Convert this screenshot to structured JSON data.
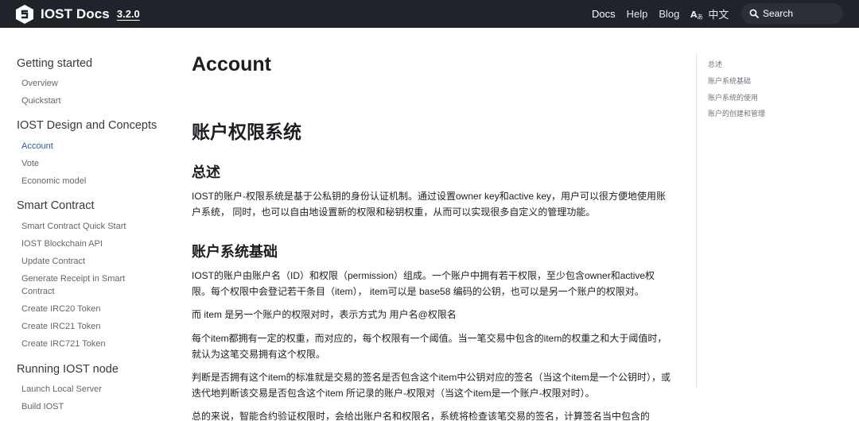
{
  "navbar": {
    "title": "IOST Docs",
    "version": "3.2.0",
    "links": [
      "Docs",
      "Help",
      "Blog"
    ],
    "language": "中文",
    "search_placeholder": "Search",
    "bg_color": "#20232a"
  },
  "sidebar": {
    "groups": [
      {
        "heading": "Getting started",
        "items": [
          "Overview",
          "Quickstart"
        ]
      },
      {
        "heading": "IOST Design and Concepts",
        "items": [
          "Account",
          "Vote",
          "Economic model"
        ]
      },
      {
        "heading": "Smart Contract",
        "items": [
          "Smart Contract Quick Start",
          "IOST Blockchain API",
          "Update Contract",
          "Generate Receipt in Smart Contract",
          "Create IRC20 Token",
          "Create IRC21 Token",
          "Create IRC721 Token"
        ]
      },
      {
        "heading": "Running IOST node",
        "items": [
          "Launch Local Server",
          "Build IOST"
        ]
      }
    ],
    "active_item": "Account",
    "active_color": "#2e5b9f"
  },
  "main": {
    "title": "Account",
    "h1": "账户权限系统",
    "sections": [
      {
        "heading": "总述",
        "paragraphs": [
          "IOST的账户-权限系统是基于公私钥的身份认证机制。通过设置owner key和active key，用户可以很方便地使用账户系统， 同时，也可以自由地设置新的权限和秘钥权重，从而可以实现很多自定义的管理功能。"
        ]
      },
      {
        "heading": "账户系统基础",
        "paragraphs": [
          "IOST的账户由账户名（ID）和权限（permission）组成。一个账户中拥有若干权限，至少包含owner和active权限。每个权限中会登记若干条目（item）， item可以是 base58 编码的公钥，也可以是另一个账户的权限对。",
          "而 item 是另一个账户的权限对时，表示方式为 用户名@权限名",
          "每个item都拥有一定的权重，而对应的，每个权限有一个阈值。当一笔交易中包含的item的权重之和大于阈值时，就认为这笔交易拥有这个权限。",
          "判断是否拥有这个item的标准就是交易的签名是否包含这个item中公钥对应的签名（当这个item是一个公钥时），或迭代地判断该交易是否包含这个item 所记录的账户-权限对（当这个item是一个账户-权限对时）。",
          "总的来说，智能合约验证权限时，会给出账户名和权限名，系统将检查该笔交易的签名，计算签名当中包含的"
        ]
      }
    ]
  },
  "toc": {
    "items": [
      "总述",
      "账户系统基础",
      "账户系统的使用",
      "账户的创建和管理"
    ]
  }
}
